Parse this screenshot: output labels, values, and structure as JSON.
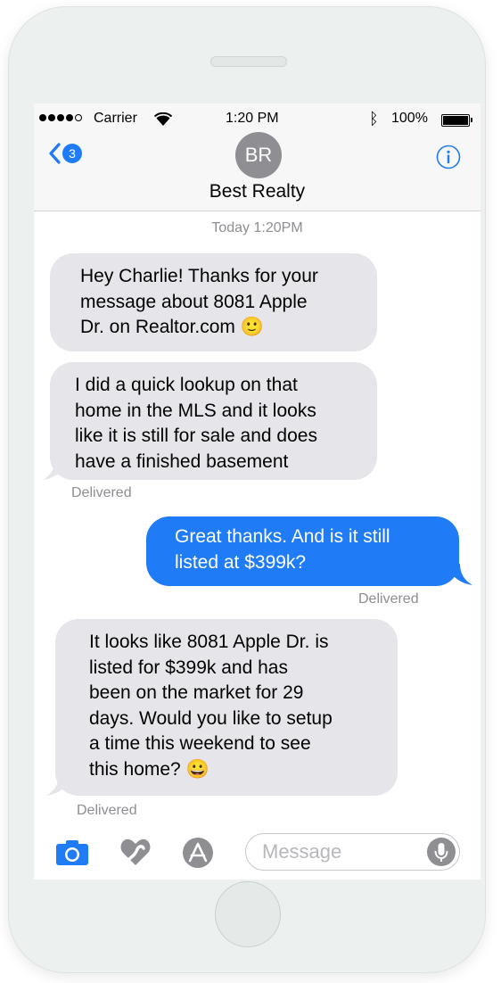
{
  "status_bar": {
    "carrier": "Carrier",
    "time": "1:20 PM",
    "battery": "100%"
  },
  "nav": {
    "back_badge": "3",
    "avatar_initials": "BR",
    "contact_name": "Best Realty"
  },
  "conversation": {
    "timestamp": "Today 1:20PM",
    "messages": [
      {
        "sender": "contact",
        "text": "Hey Charlie! Thanks for your\nmessage about 8081 Apple\nDr. on Realtor.com 🙂"
      },
      {
        "sender": "contact",
        "text": "I did a quick lookup on that\nhome in the MLS and it looks\nlike it is still for sale and does\nhave a finished basement",
        "status": "Delivered"
      },
      {
        "sender": "me",
        "text": "Great thanks. And is it still\nlisted at $399k?",
        "status": "Delivered"
      },
      {
        "sender": "contact",
        "text": "It looks like 8081 Apple Dr. is\nlisted for $399k and has\nbeen on the market for 29\ndays. Would you like to setup\na time this weekend to see\nthis home? 😀",
        "status": "Delivered"
      }
    ]
  },
  "input": {
    "placeholder": "Message",
    "value": ""
  },
  "colors": {
    "accent": "#1f7cf6",
    "incoming_bubble": "#e5e5ea",
    "secondary_text": "#8e8e93"
  },
  "icons": [
    "signal-icon",
    "wifi-icon",
    "bluetooth-icon",
    "battery-icon",
    "back-chevron-icon",
    "info-icon",
    "camera-icon",
    "digital-touch-icon",
    "app-store-icon",
    "microphone-icon"
  ]
}
